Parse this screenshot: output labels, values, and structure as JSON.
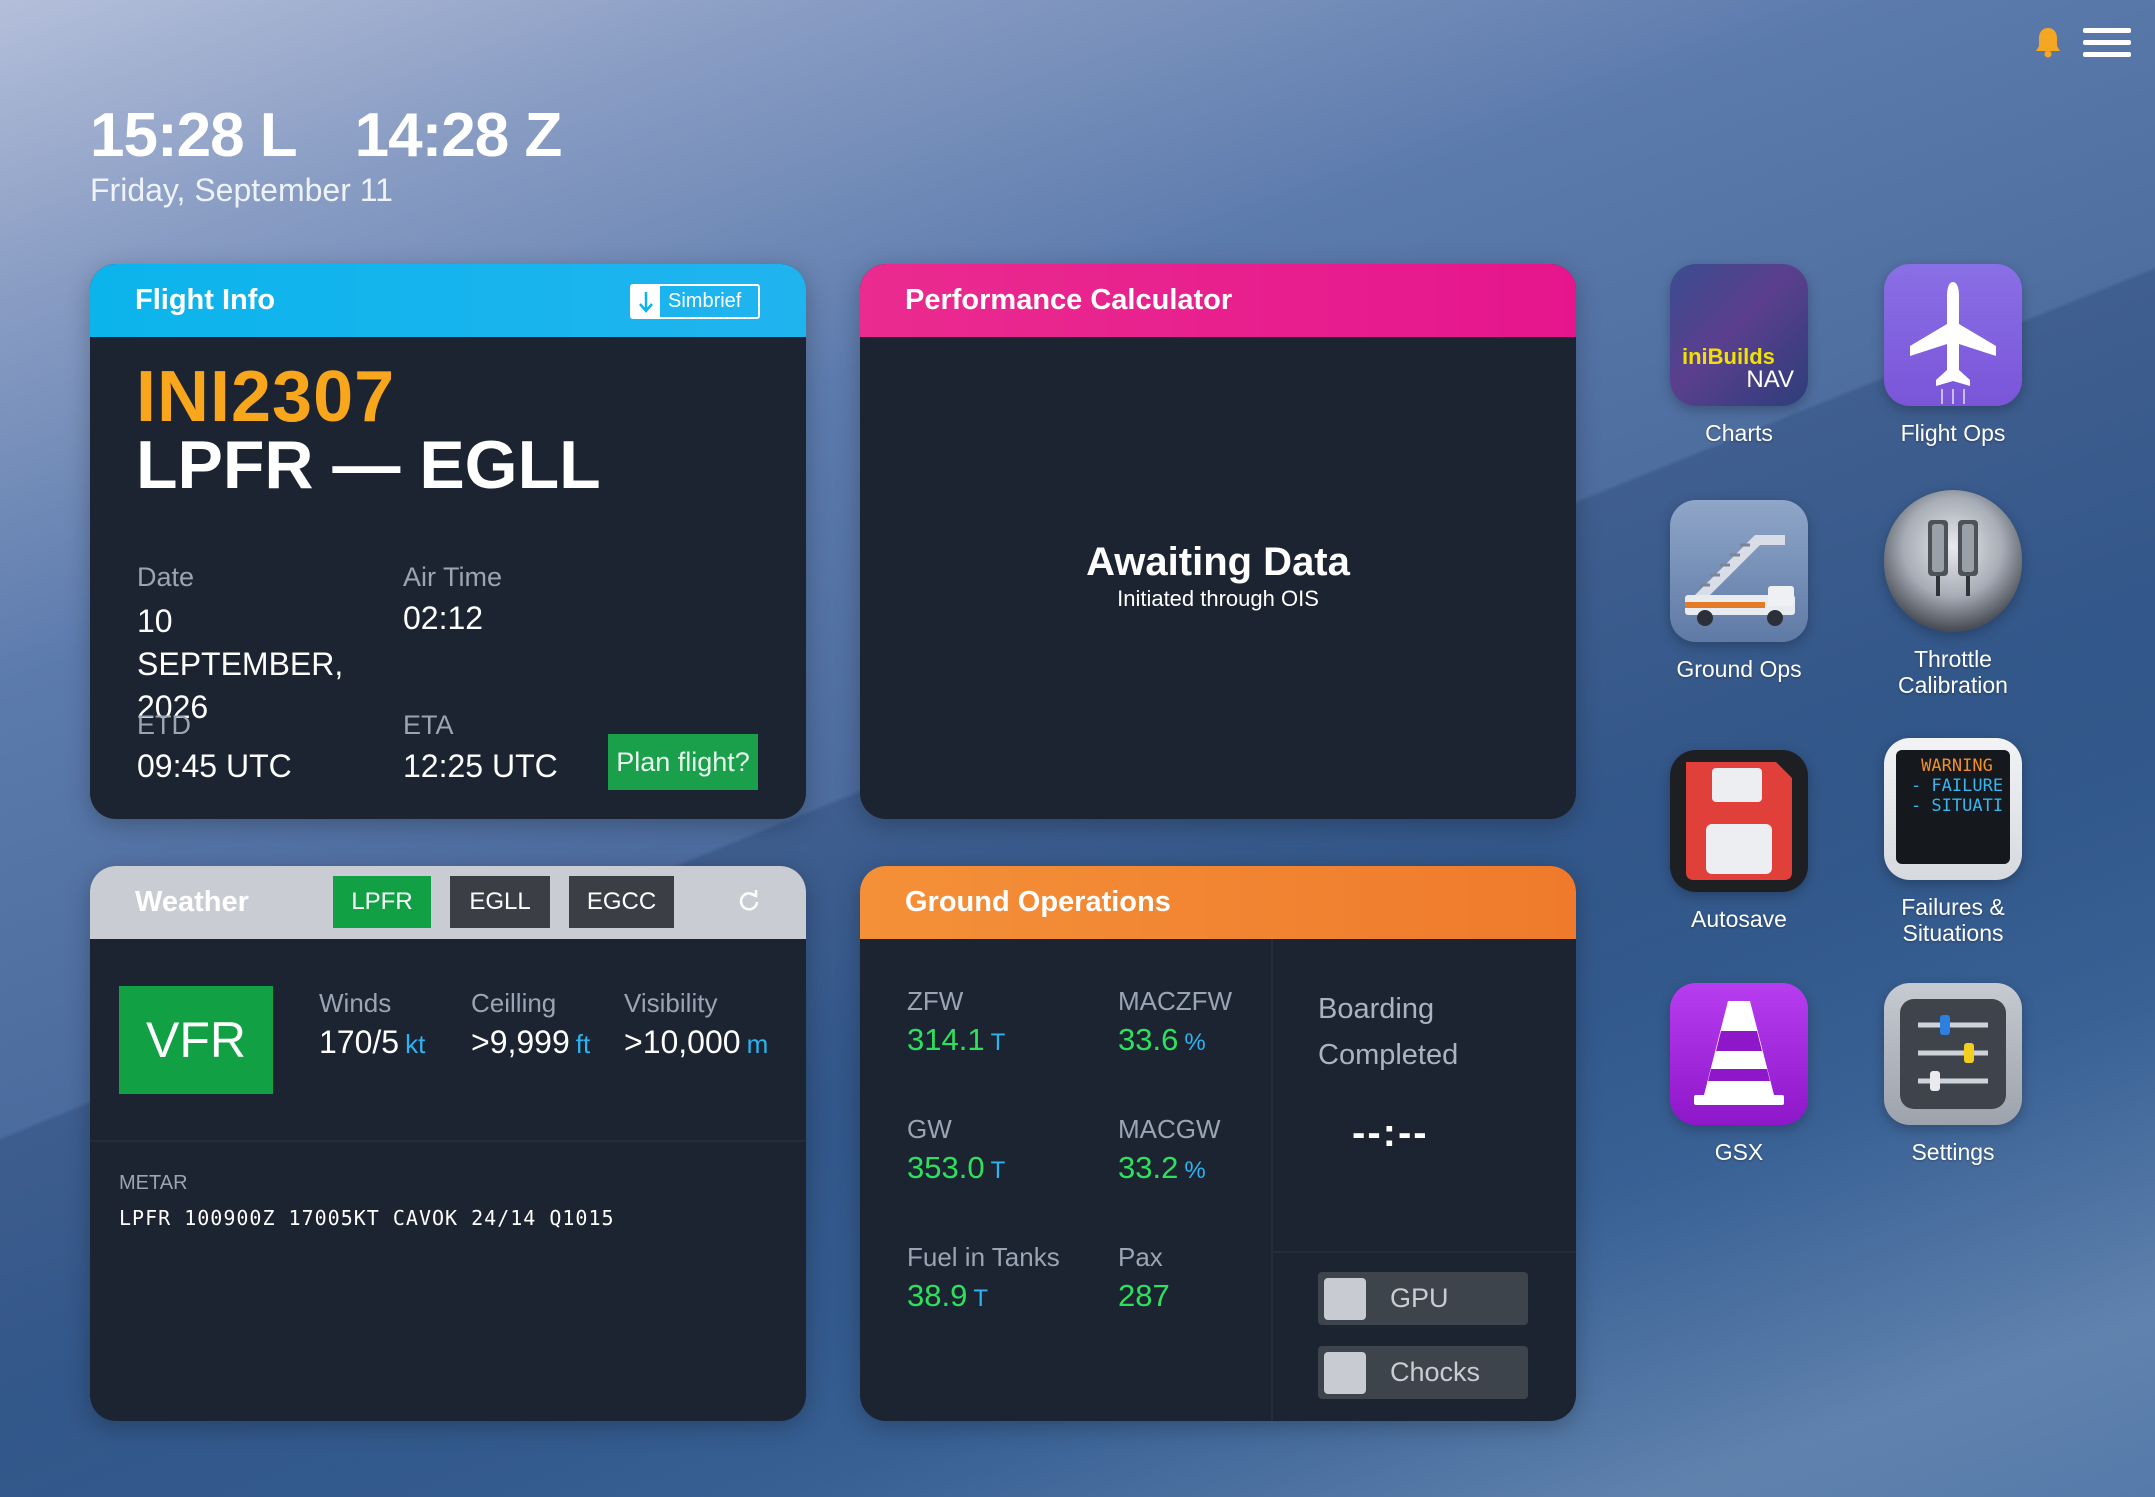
{
  "clock": {
    "local": "15:28 L",
    "zulu": "14:28 Z",
    "date": "Friday, September 11"
  },
  "flight_info": {
    "title": "Flight Info",
    "simbrief_label": "Simbrief",
    "callsign": "INI2307",
    "route": "LPFR — EGLL",
    "date_label": "Date",
    "date_value": "10 SEPTEMBER, 2026",
    "airtime_label": "Air Time",
    "airtime_value": "02:12",
    "etd_label": "ETD",
    "etd_value": "09:45 UTC",
    "eta_label": "ETA",
    "eta_value": "12:25 UTC",
    "plan_button": "Plan flight?"
  },
  "performance": {
    "title": "Performance Calculator",
    "status": "Awaiting Data",
    "status_sub": "Initiated through OIS"
  },
  "weather": {
    "title": "Weather",
    "tabs": [
      "LPFR",
      "EGLL",
      "EGCC"
    ],
    "active_tab": "LPFR",
    "flight_rules": "VFR",
    "winds_label": "Winds",
    "winds_value": "170/5",
    "winds_unit": "kt",
    "ceiling_label": "Ceilling",
    "ceiling_value": ">9,999",
    "ceiling_unit": "ft",
    "visibility_label": "Visibility",
    "visibility_value": ">10,000",
    "visibility_unit": "m",
    "metar_label": "METAR",
    "metar": "LPFR 100900Z 17005KT CAVOK 24/14 Q1015"
  },
  "ground_ops": {
    "title": "Ground Operations",
    "zfw_label": "ZFW",
    "zfw_value": "314.1",
    "zfw_unit": "T",
    "maczfw_label": "MACZFW",
    "maczfw_value": "33.6",
    "maczfw_unit": "%",
    "gw_label": "GW",
    "gw_value": "353.0",
    "gw_unit": "T",
    "macgw_label": "MACGW",
    "macgw_value": "33.2",
    "macgw_unit": "%",
    "fuel_label": "Fuel in Tanks",
    "fuel_value": "38.9",
    "fuel_unit": "T",
    "pax_label": "Pax",
    "pax_value": "287",
    "boarding_line1": "Boarding",
    "boarding_line2": "Completed",
    "boarding_time": "--:--",
    "gpu_label": "GPU",
    "chocks_label": "Chocks"
  },
  "apps": {
    "charts": {
      "label": "Charts",
      "logo_top": "iniBuilds",
      "logo_bottom": "NAV"
    },
    "flight_ops": {
      "label": "Flight Ops"
    },
    "ground_ops": {
      "label": "Ground Ops"
    },
    "throttle": {
      "label1": "Throttle",
      "label2": "Calibration"
    },
    "autosave": {
      "label": "Autosave"
    },
    "failures": {
      "label1": "Failures &",
      "label2": "Situations",
      "screen_l1": "WARNING",
      "screen_l2": "- FAILURE",
      "screen_l3": "- SITUATI"
    },
    "gsx": {
      "label": "GSX"
    },
    "settings": {
      "label": "Settings"
    }
  },
  "colors": {
    "flight_info_header": "#0cb4ec",
    "performance_header": "#e6158d",
    "ground_ops_header": "#ef7a2c",
    "weather_header": "#c9ccd2",
    "active_green": "#12a044",
    "callsign_orange": "#f8a61c",
    "value_green": "#2ee05e",
    "unit_blue": "#2db3f0"
  }
}
